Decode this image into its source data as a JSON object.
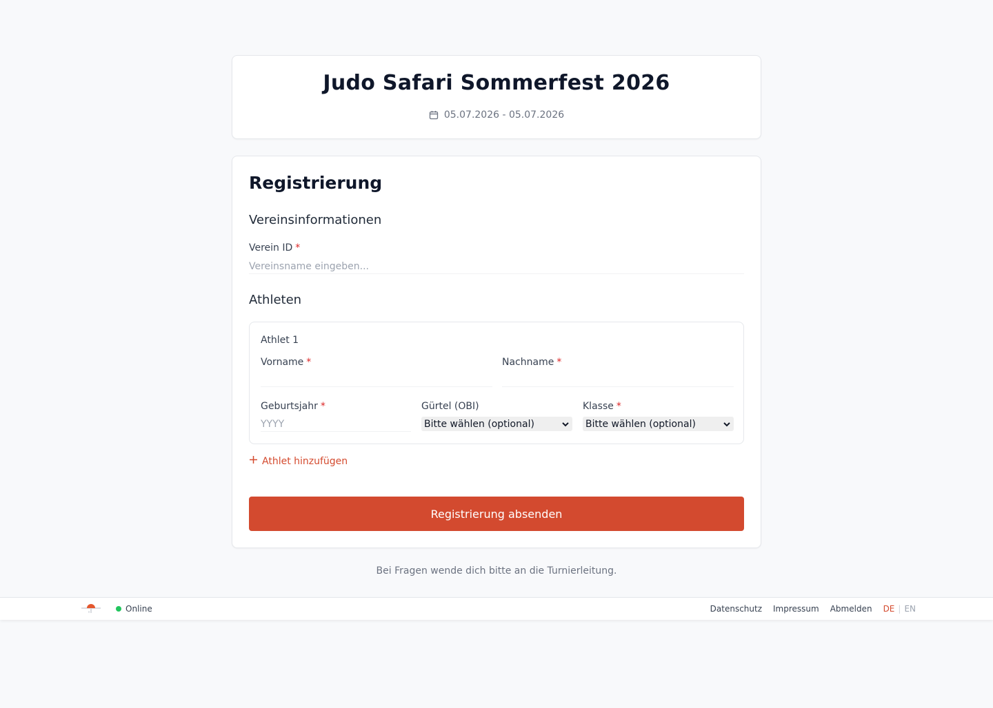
{
  "event": {
    "title": "Judo Safari Sommerfest 2026",
    "dates": "05.07.2026 - 05.07.2026"
  },
  "registration": {
    "title": "Registrierung",
    "club_section": "Vereinsinformationen",
    "club_label": "Verein ID",
    "club_placeholder": "Vereinsname eingeben...",
    "required_mark": "*",
    "athletes_section": "Athleten",
    "athlete": {
      "title": "Athlet 1",
      "first_name_label": "Vorname",
      "first_name_value": "",
      "last_name_label": "Nachname",
      "last_name_value": "",
      "birth_year_label": "Geburtsjahr",
      "birth_year_placeholder": "YYYY",
      "belt_label": "Gürtel (OBI)",
      "belt_selected": "Bitte wählen (optional)",
      "class_label": "Klasse",
      "class_selected": "Bitte wählen (optional)"
    },
    "add_athlete": "Athlet hinzufügen",
    "submit": "Registrierung absenden"
  },
  "help_text": "Bei Fragen wende dich bitte an die Turnierleitung.",
  "footer": {
    "status": "Online",
    "links": {
      "privacy": "Datenschutz",
      "imprint": "Impressum",
      "logout": "Abmelden"
    },
    "lang": {
      "de": "DE",
      "separator": "|",
      "en": "EN"
    }
  },
  "icons": {
    "calendar": "calendar-icon",
    "plus": "plus-icon",
    "chevron": "chevron-down-icon",
    "logo": "judo-logo-icon"
  },
  "colors": {
    "accent": "#d34a2f",
    "online": "#22c55e",
    "required": "#dc2626"
  }
}
